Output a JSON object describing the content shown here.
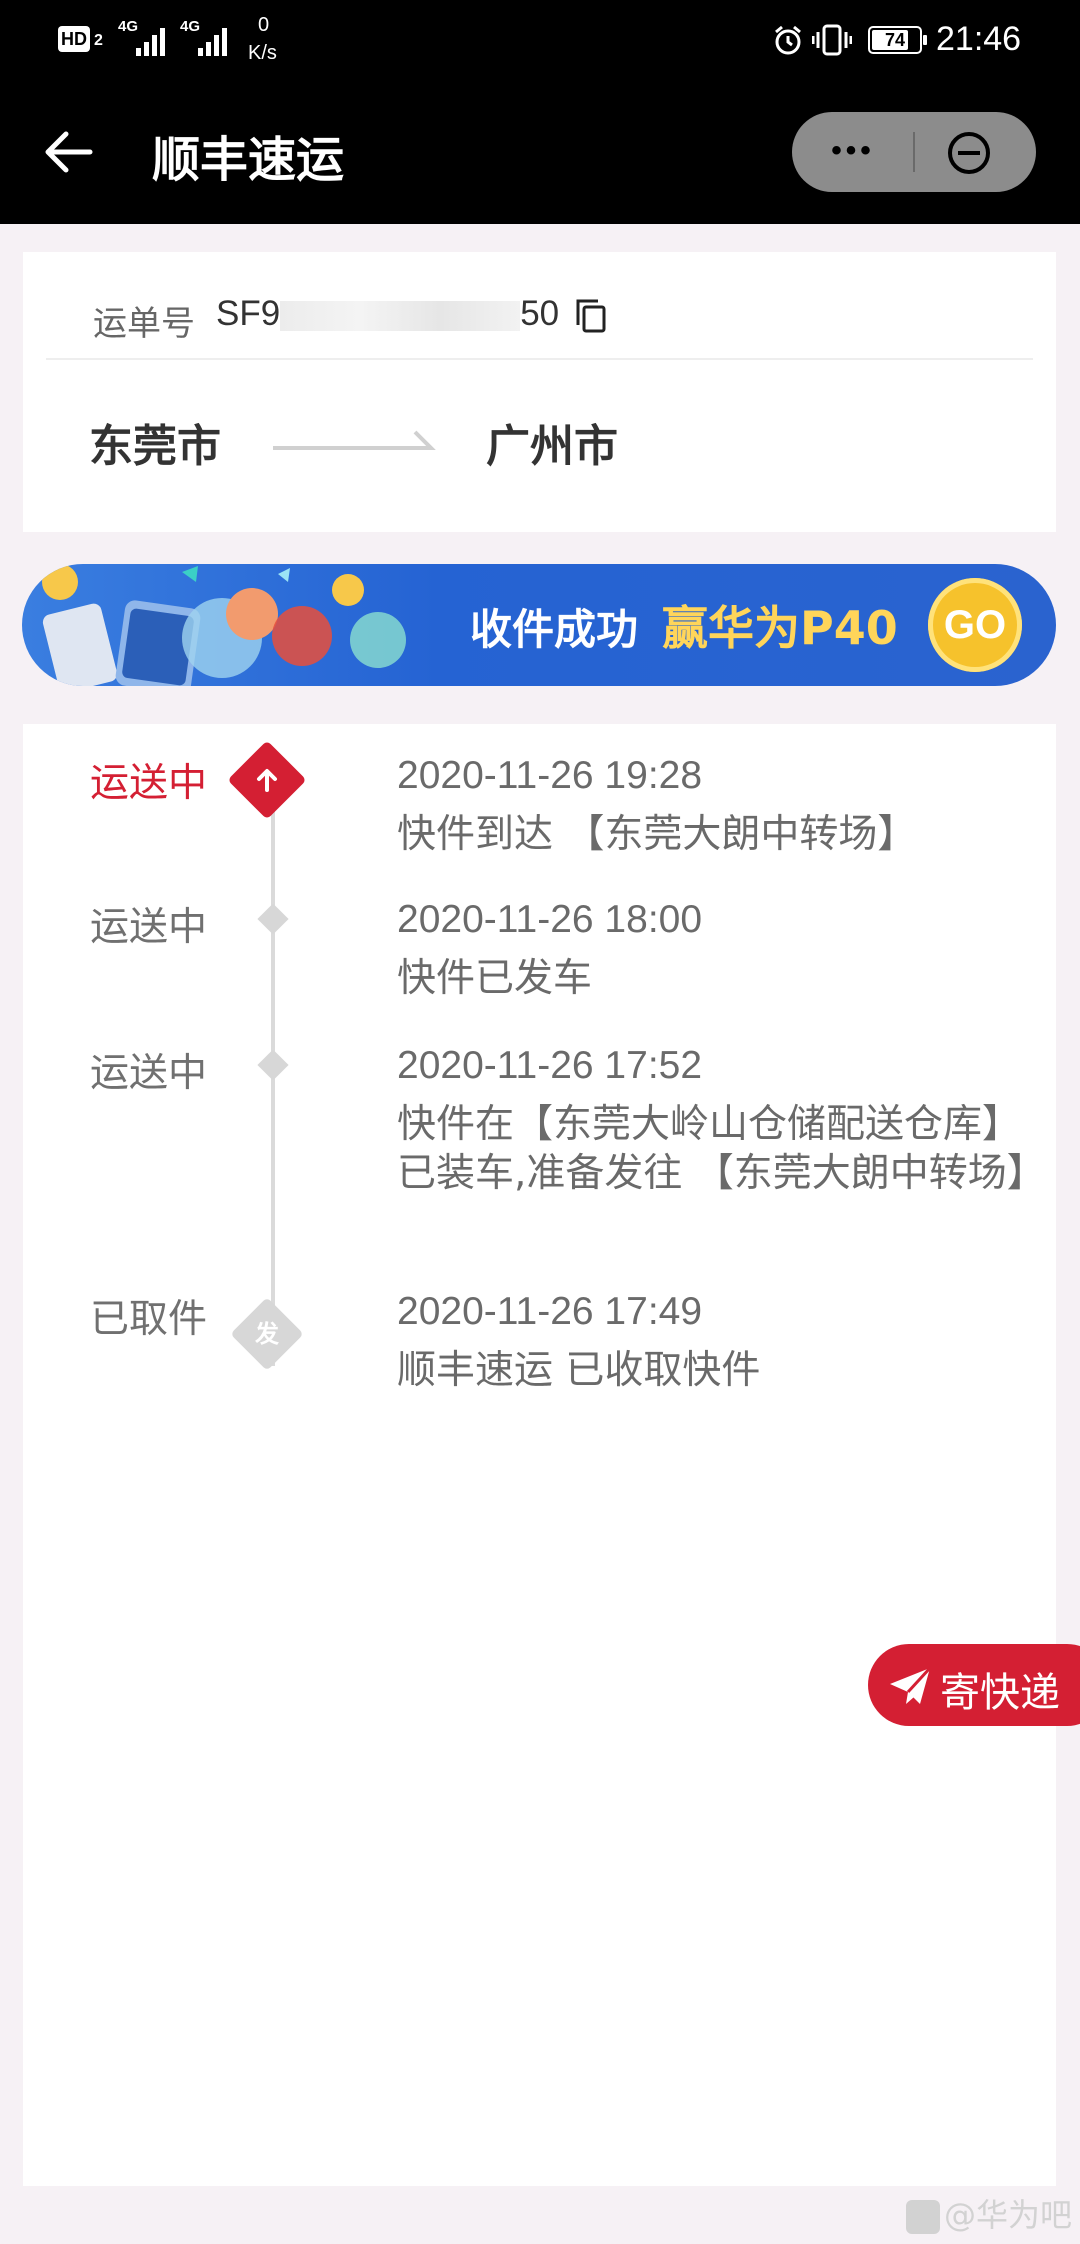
{
  "status_bar": {
    "hd_badge": "HD",
    "hd_sub": "2",
    "net1": "4G",
    "net2": "4G",
    "speed_value": "0",
    "speed_unit": "K/s",
    "battery": "74",
    "time": "21:46"
  },
  "nav": {
    "title": "顺丰速运",
    "more_label": "•••"
  },
  "waybill": {
    "label": "运单号",
    "number": "SF9",
    "number_tail": "50",
    "from_city": "东莞市",
    "to_city": "广州市"
  },
  "banner": {
    "text_main": "收件成功",
    "text_highlight": "赢华为P40",
    "go_label": "GO"
  },
  "timeline": [
    {
      "status": "运送中",
      "time": "2020-11-26 19:28",
      "desc": "快件到达 【东莞大朗中转场】",
      "active": true
    },
    {
      "status": "运送中",
      "time": "2020-11-26 18:00",
      "desc": "快件已发车",
      "active": false
    },
    {
      "status": "运送中",
      "time": "2020-11-26 17:52",
      "desc": "快件在【东莞大岭山仓储配送仓库】已装车,准备发往 【东莞大朗中转场】",
      "active": false
    },
    {
      "status": "已取件",
      "time": "2020-11-26 17:49",
      "desc": "顺丰速运 已收取快件",
      "active": false
    }
  ],
  "origin_marker_label": "发",
  "send_button": {
    "label": "寄快递"
  },
  "watermark": "@华为吧",
  "colors": {
    "accent_red": "#d41f33",
    "timeline_gray": "#d7d7d7"
  }
}
